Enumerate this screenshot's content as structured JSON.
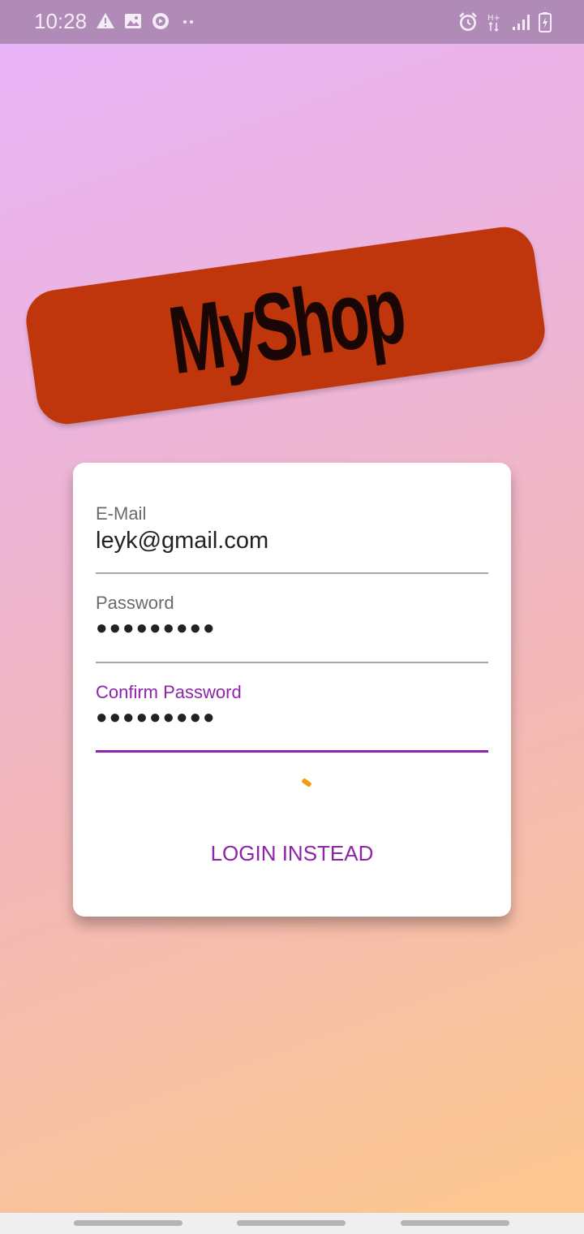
{
  "status_bar": {
    "time": "10:28",
    "left_icons": [
      "warning-icon",
      "image-icon",
      "play-circle-icon",
      "more-dots-icon"
    ],
    "right_icons": [
      "alarm-icon",
      "network-hplus-icon",
      "signal-icon",
      "battery-charging-icon"
    ]
  },
  "logo": {
    "text": "MyShop",
    "color": "#c0360c"
  },
  "form": {
    "email": {
      "label": "E-Mail",
      "value": "leyk@gmail.com"
    },
    "password": {
      "label": "Password",
      "value": "●●●●●●●●●"
    },
    "confirm_password": {
      "label": "Confirm Password",
      "value": "●●●●●●●●●"
    }
  },
  "login_instead_label": "LOGIN INSTEAD",
  "colors": {
    "accent": "#8e24aa",
    "spinner": "#f39c12"
  }
}
